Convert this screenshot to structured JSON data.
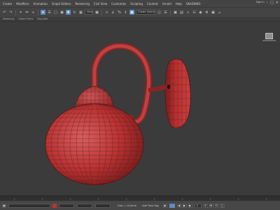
{
  "menu": {
    "items": [
      "Create",
      "Modifiers",
      "Animation",
      "Graph Editors",
      "Rendering",
      "Civil View",
      "Customize",
      "Scripting",
      "Content",
      "Arnold",
      "Help",
      "SKAZKINO"
    ]
  },
  "window_controls": {
    "sign_in_label": "Sign In",
    "icons": [
      "minimize-icon",
      "maximize-icon",
      "close-icon"
    ]
  },
  "toolbar": {
    "view_dropdown": "View",
    "selection_set_dropdown": "Create Selection Set",
    "icons": [
      "undo-icon",
      "redo-icon",
      "link-icon",
      "unlink-icon",
      "bind-icon",
      "select-icon",
      "select-by-name-icon",
      "rect-select-icon",
      "window-crossing-icon",
      "move-icon",
      "rotate-icon",
      "scale-icon",
      "pivot-icon",
      "snap-icon",
      "angle-snap-icon",
      "percent-snap-icon",
      "spinner-snap-icon",
      "mirror-icon",
      "align-icon",
      "layer-icon",
      "ribbon-icon",
      "curve-editor-icon",
      "schematic-icon",
      "material-editor-icon",
      "render-setup-icon",
      "render-frame-icon",
      "render-icon"
    ]
  },
  "ribbon": {
    "labels": [
      "Modeling",
      "Object Paint",
      "Populate"
    ]
  },
  "viewport": {
    "object": "wall-lamp-mesh",
    "wire_color": "#c83232",
    "background_color": "#3b3b3b"
  },
  "statusbar": {
    "frame_value": "0",
    "grid_label": "Grid = 10,0mm",
    "add_time_tag_label": "Add Time Tag"
  }
}
